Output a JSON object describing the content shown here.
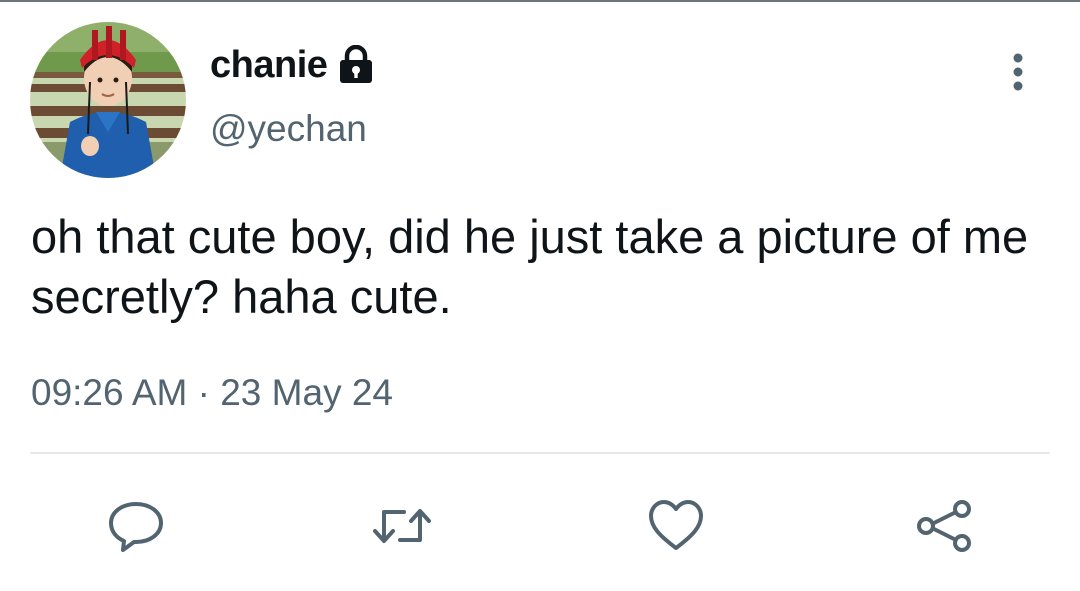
{
  "tweet": {
    "author": {
      "display_name": "chanie",
      "handle": "@yechan",
      "protected": true,
      "avatar_alt": "avatar-photo"
    },
    "text": "oh that cute boy, did he just take a picture of me secretly? haha cute.",
    "time": "09:26 AM",
    "separator": "·",
    "date": "23 May 24"
  },
  "icons": {
    "lock": "lock-icon",
    "more": "more-vertical-icon",
    "reply": "reply-icon",
    "retweet": "retweet-icon",
    "like": "heart-icon",
    "share": "share-icon"
  },
  "colors": {
    "text_primary": "#0f1419",
    "text_secondary": "#536471",
    "icon": "#536471",
    "divider": "#e6e8ea"
  }
}
